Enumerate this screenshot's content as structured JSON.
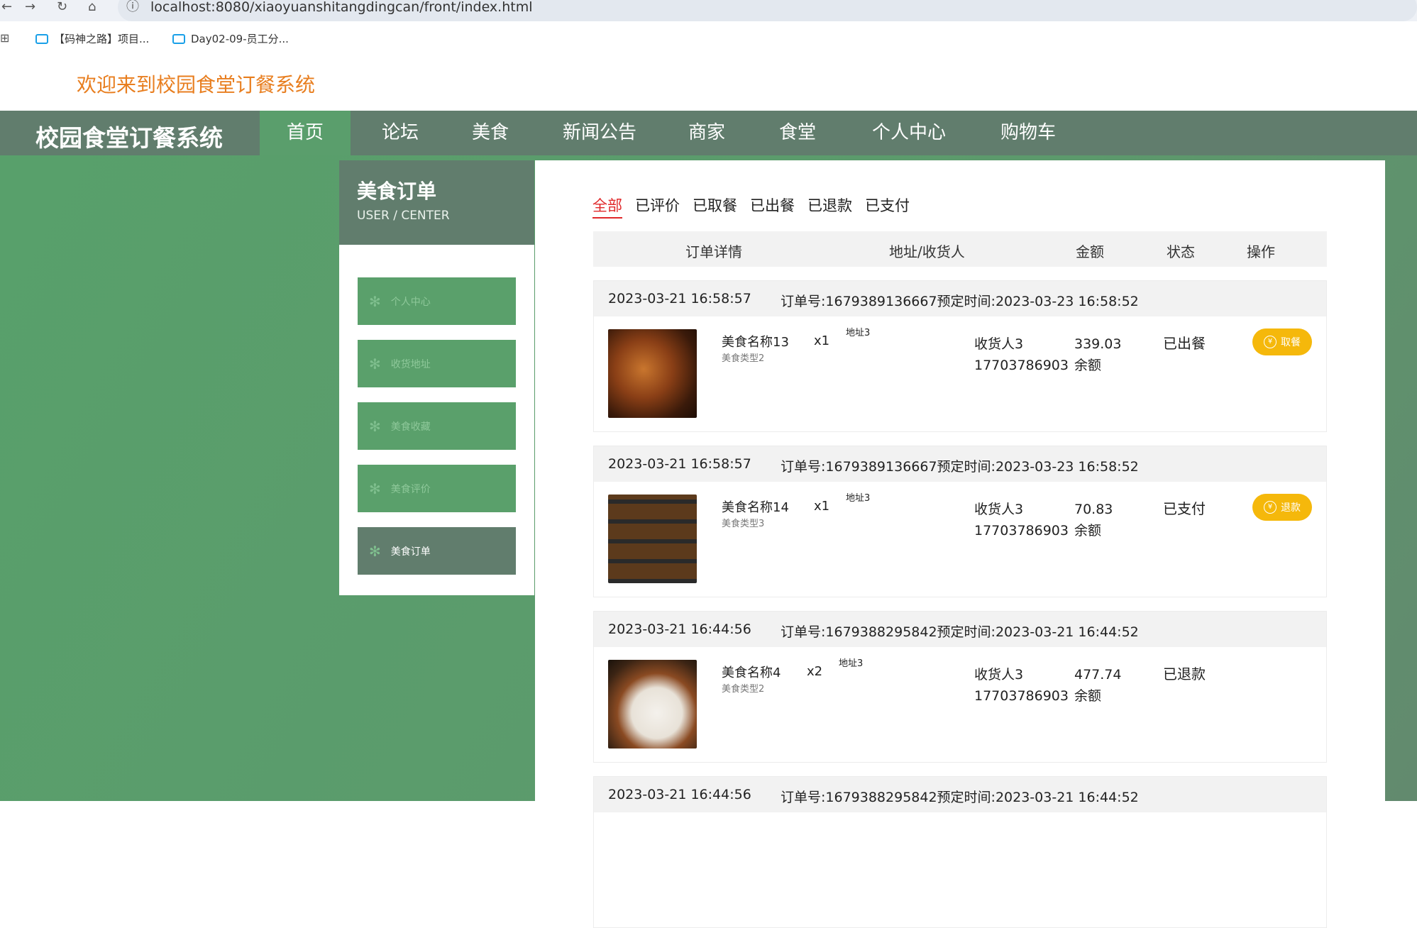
{
  "browser": {
    "url": "localhost:8080/xiaoyuanshitangdingcan/front/index.html",
    "bookmarks": [
      "【码神之路】项目...",
      "Day02-09-员工分..."
    ]
  },
  "welcome": "欢迎来到校园食堂订餐系统",
  "nav": {
    "brand": "校园食堂订餐系统",
    "items": [
      "首页",
      "论坛",
      "美食",
      "新闻公告",
      "商家",
      "食堂",
      "个人中心",
      "购物车"
    ],
    "active": "首页"
  },
  "sidebar": {
    "title": "美食订单",
    "subtitle": "USER / CENTER",
    "items": [
      "个人中心",
      "收货地址",
      "美食收藏",
      "美食评价",
      "美食订单"
    ],
    "active": "美食订单"
  },
  "tabs": [
    "全部",
    "已评价",
    "已取餐",
    "已出餐",
    "已退款",
    "已支付"
  ],
  "table_headers": [
    "订单详情",
    "地址/收货人",
    "金额",
    "状态",
    "操作"
  ],
  "orders": [
    {
      "time": "2023-03-21 16:58:57",
      "order_line": "订单号:1679389136667预定时间:2023-03-23 16:58:52",
      "name": "美食名称13",
      "type": "美食类型2",
      "qty": "x1",
      "address": "地址3",
      "receiver": "收货人3",
      "phone": "17703786903",
      "amount": "339.03",
      "pay_method": "余额",
      "status": "已出餐",
      "action": "取餐"
    },
    {
      "time": "2023-03-21 16:58:57",
      "order_line": "订单号:1679389136667预定时间:2023-03-23 16:58:52",
      "name": "美食名称14",
      "type": "美食类型3",
      "qty": "x1",
      "address": "地址3",
      "receiver": "收货人3",
      "phone": "17703786903",
      "amount": "70.83",
      "pay_method": "余额",
      "status": "已支付",
      "action": "退款"
    },
    {
      "time": "2023-03-21 16:44:56",
      "order_line": "订单号:1679388295842预定时间:2023-03-21 16:44:52",
      "name": "美食名称4",
      "type": "美食类型2",
      "qty": "x2",
      "address": "地址3",
      "receiver": "收货人3",
      "phone": "17703786903",
      "amount": "477.74",
      "pay_method": "余额",
      "status": "已退款",
      "action": ""
    },
    {
      "time": "2023-03-21 16:44:56",
      "order_line": "订单号:1679388295842预定时间:2023-03-21 16:44:52"
    }
  ],
  "icons": {
    "yen": "¥"
  }
}
